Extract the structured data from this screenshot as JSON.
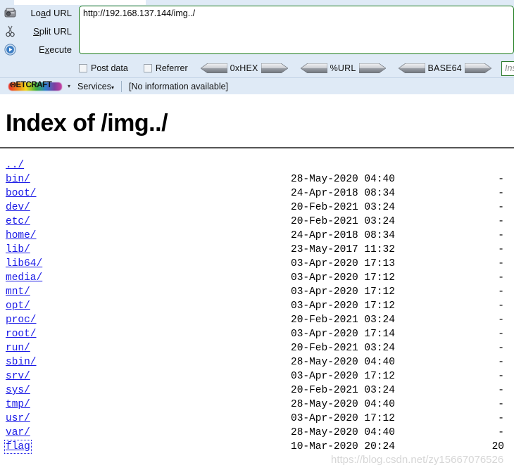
{
  "hackbar": {
    "actions": [
      {
        "label": "Load URL",
        "accel": "a",
        "icon": "load-url-icon"
      },
      {
        "label": "Split URL",
        "accel": "S",
        "icon": "scissors-icon"
      },
      {
        "label": "Execute",
        "accel": "x",
        "icon": "execute-play-icon"
      }
    ],
    "url_value": "http://192.168.137.144/img../",
    "url_placeholder": "",
    "checkboxes": [
      {
        "label": "Post data",
        "checked": false
      },
      {
        "label": "Referrer",
        "checked": false
      }
    ],
    "encoders": [
      {
        "label": "0xHEX"
      },
      {
        "label": "%URL"
      },
      {
        "label": "BASE64"
      }
    ],
    "insert_string_placeholder": "Insert string",
    "insert_string_value": ""
  },
  "netcraft": {
    "logo_text": "ETCRAFT",
    "logo_initial": "N",
    "dropdown_caret": "▾",
    "services_label": "Services",
    "services_caret": "▾",
    "info_text": "[No information available]"
  },
  "page": {
    "title": "Index of /img../",
    "watermark": "https://blog.csdn.net/zy15667076526",
    "entries": [
      {
        "name": "../",
        "date": "",
        "size": ""
      },
      {
        "name": "bin/",
        "date": "28-May-2020 04:40",
        "size": "-"
      },
      {
        "name": "boot/",
        "date": "24-Apr-2018 08:34",
        "size": "-"
      },
      {
        "name": "dev/",
        "date": "20-Feb-2021 03:24",
        "size": "-"
      },
      {
        "name": "etc/",
        "date": "20-Feb-2021 03:24",
        "size": "-"
      },
      {
        "name": "home/",
        "date": "24-Apr-2018 08:34",
        "size": "-"
      },
      {
        "name": "lib/",
        "date": "23-May-2017 11:32",
        "size": "-"
      },
      {
        "name": "lib64/",
        "date": "03-Apr-2020 17:13",
        "size": "-"
      },
      {
        "name": "media/",
        "date": "03-Apr-2020 17:12",
        "size": "-"
      },
      {
        "name": "mnt/",
        "date": "03-Apr-2020 17:12",
        "size": "-"
      },
      {
        "name": "opt/",
        "date": "03-Apr-2020 17:12",
        "size": "-"
      },
      {
        "name": "proc/",
        "date": "20-Feb-2021 03:24",
        "size": "-"
      },
      {
        "name": "root/",
        "date": "03-Apr-2020 17:14",
        "size": "-"
      },
      {
        "name": "run/",
        "date": "20-Feb-2021 03:24",
        "size": "-"
      },
      {
        "name": "sbin/",
        "date": "28-May-2020 04:40",
        "size": "-"
      },
      {
        "name": "srv/",
        "date": "03-Apr-2020 17:12",
        "size": "-"
      },
      {
        "name": "sys/",
        "date": "20-Feb-2021 03:24",
        "size": "-"
      },
      {
        "name": "tmp/",
        "date": "28-May-2020 04:40",
        "size": "-"
      },
      {
        "name": "usr/",
        "date": "03-Apr-2020 17:12",
        "size": "-"
      },
      {
        "name": "var/",
        "date": "28-May-2020 04:40",
        "size": "-"
      },
      {
        "name": "flag",
        "date": "10-Mar-2020 20:24",
        "size": "20",
        "focused": true
      }
    ]
  },
  "colors": {
    "toolbar_bg": "#dfeaf6",
    "input_border_green": "#1a7a1a",
    "link_blue": "#1a1ae6",
    "rule_gray": "#555555",
    "watermark_gray": "#d6d6d6"
  }
}
